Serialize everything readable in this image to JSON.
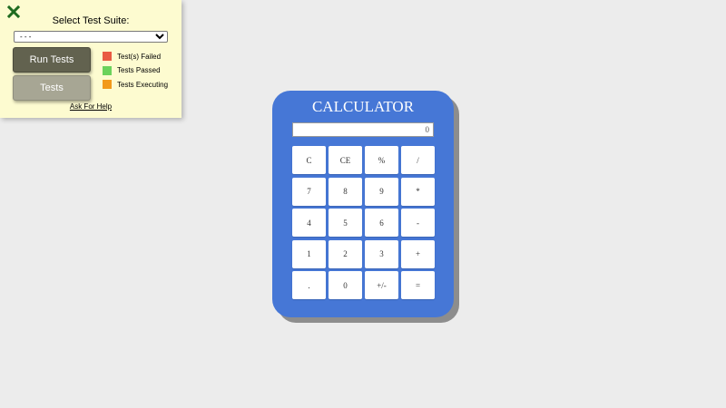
{
  "test_panel": {
    "title": "Select Test Suite:",
    "suite_select_value": "- - -",
    "run_tests_label": "Run Tests",
    "tests_label": "Tests",
    "legend": [
      {
        "label": "Test(s) Failed",
        "color": "#e95a43"
      },
      {
        "label": "Tests Passed",
        "color": "#6bd25b"
      },
      {
        "label": "Tests Executing",
        "color": "#f29a1b"
      }
    ],
    "help_link": "Ask For Help",
    "close_icon": "close-x-icon",
    "close_color": "#1f6b1f"
  },
  "calculator": {
    "title": "CALCULATOR",
    "display_value": "0",
    "keys": [
      [
        "C",
        "CE",
        "%",
        "/"
      ],
      [
        "7",
        "8",
        "9",
        "*"
      ],
      [
        "4",
        "5",
        "6",
        "-"
      ],
      [
        "1",
        "2",
        "3",
        "+"
      ],
      [
        ".",
        "0",
        "+/-",
        "="
      ]
    ],
    "body_color": "#4677d6"
  }
}
